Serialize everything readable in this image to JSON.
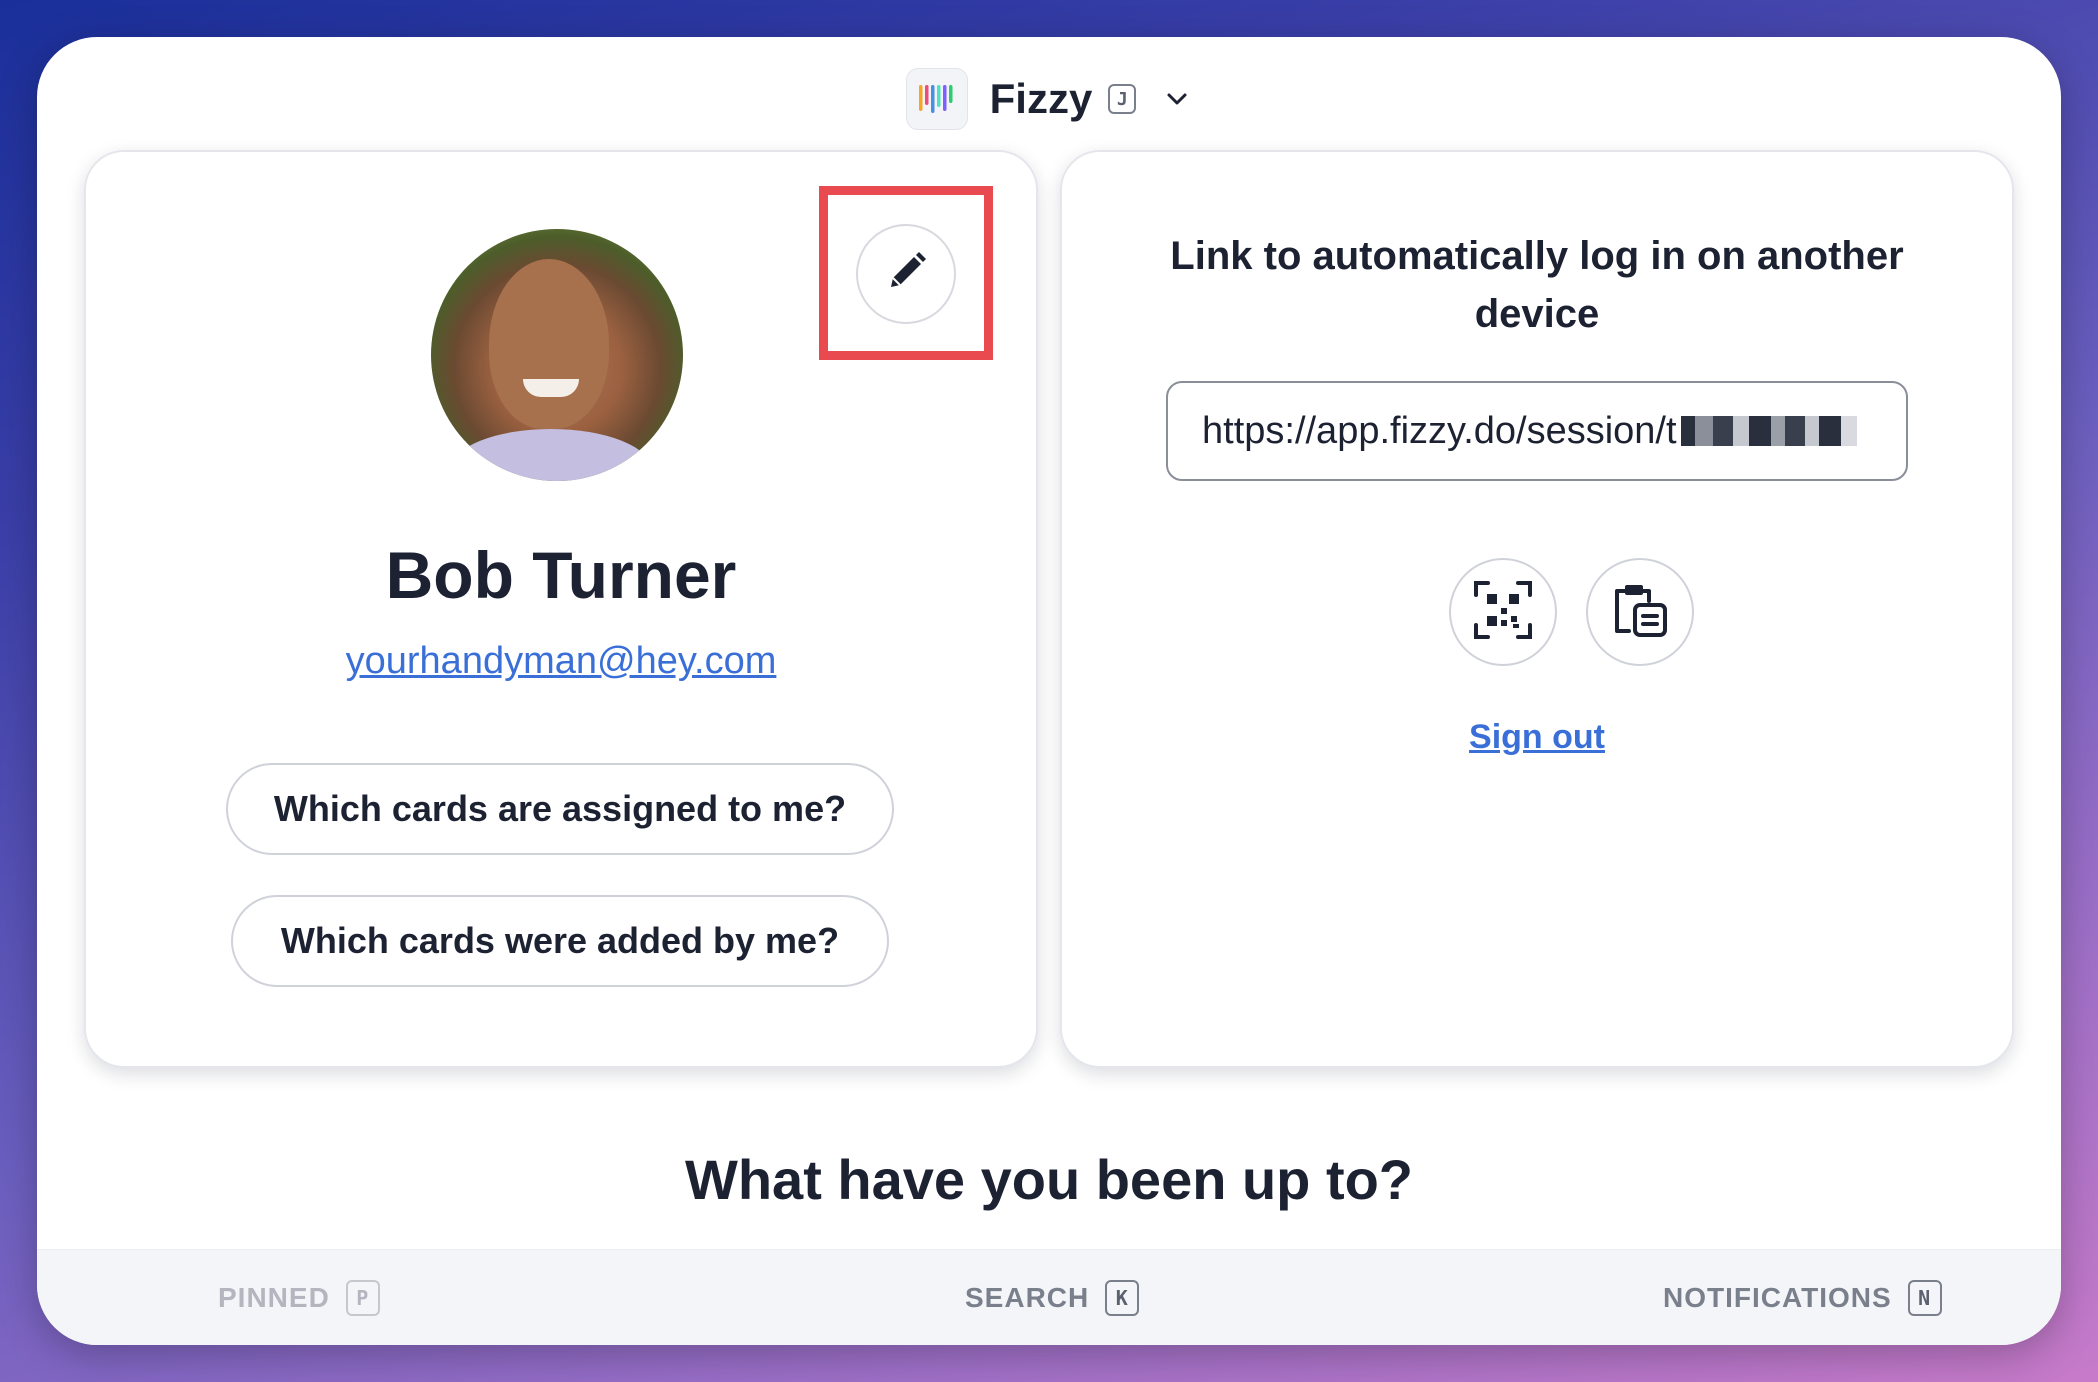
{
  "header": {
    "app_name": "Fizzy",
    "shortcut_key": "J",
    "logo_colors": [
      "#f5a623",
      "#e94e77",
      "#4a90e2",
      "#50e3c2",
      "#7b61ff",
      "#2ecc71"
    ]
  },
  "profile": {
    "name": "Bob Turner",
    "email": "yourhandyman@hey.com",
    "buttons": {
      "assigned": "Which cards are assigned to me?",
      "added": "Which cards were added by me?"
    },
    "edit_icon": "pencil-icon",
    "highlight_color": "#e84a4f"
  },
  "login_link": {
    "heading": "Link to automatically log in on another device",
    "url_visible": "https://app.fizzy.do/session/t",
    "qr_icon": "qr-code-icon",
    "copy_icon": "clipboard-icon",
    "sign_out": "Sign out"
  },
  "activity": {
    "heading": "What have you been up to?"
  },
  "footer": {
    "pinned": {
      "label": "PINNED",
      "key": "P"
    },
    "search": {
      "label": "SEARCH",
      "key": "K"
    },
    "notifications": {
      "label": "NOTIFICATIONS",
      "key": "N"
    }
  },
  "colors": {
    "link": "#3a6fd8",
    "text": "#1d2233"
  }
}
